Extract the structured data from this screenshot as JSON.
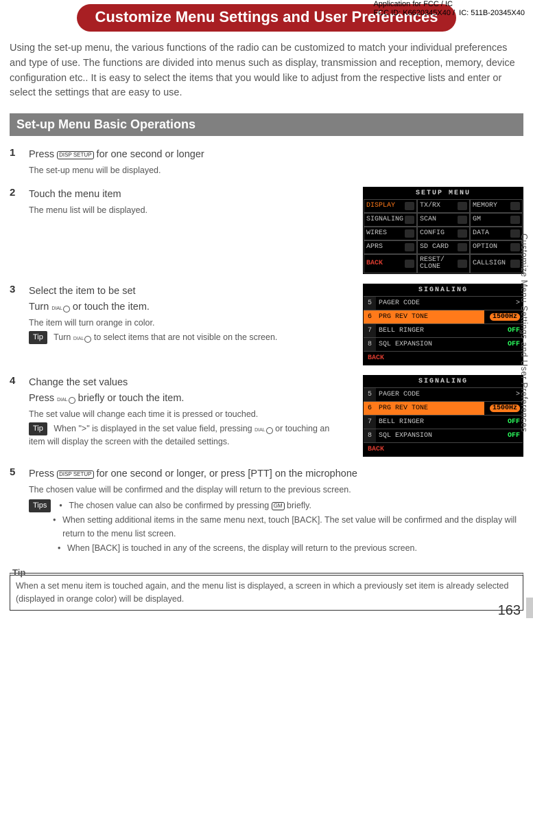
{
  "header": {
    "fcc_line1": "Application for FCC / IC",
    "fcc_line2": "FCC ID: K6620345X40 /  IC: 511B-20345X40",
    "banner": "Customize Menu Settings and User Preferences"
  },
  "intro": "Using the set-up menu, the various functions of the radio can be customized to match your individual preferences and type of use. The functions are divided into menus such as display, transmission and reception, memory, device configuration etc.. It is easy to select the items that you would like to adjust from the respective lists and enter or select the settings that are easy to use.",
  "section_title": "Set-up Menu Basic Operations",
  "keys": {
    "disp": "DISP\nSETUP",
    "gm": "GM"
  },
  "steps": {
    "s1": {
      "num": "1",
      "title_a": "Press ",
      "title_b": " for one second or longer",
      "sub": "The set-up menu will be displayed."
    },
    "s2": {
      "num": "2",
      "title": "Touch the menu item",
      "sub": "The menu list will be displayed."
    },
    "s3": {
      "num": "3",
      "title": "Select the item to be set",
      "line_a": "Turn ",
      "line_b": " or touch the item.",
      "sub": "The item will turn orange in color.",
      "tip_a": "Turn ",
      "tip_b": " to select items that are not visible on the screen."
    },
    "s4": {
      "num": "4",
      "title": "Change the set values",
      "line_a": "Press ",
      "line_b": " briefly or touch the item.",
      "sub": "The set value will change each time it is pressed or touched.",
      "tip_a": "When \">\" is displayed in the set value field, pressing ",
      "tip_b": " or touching an item will display the screen with the detailed settings."
    },
    "s5": {
      "num": "5",
      "title_a": "Press ",
      "title_b": " for one second or longer, or press [PTT] on the microphone",
      "sub": "The chosen value will be confirmed and the display will return to the previous screen.",
      "tips": {
        "t1a": "The chosen value can also be confirmed by pressing ",
        "t1b": " briefly.",
        "t2": "When setting additional items in the same menu next, touch [BACK]. The set value will be confirmed and the display will return to the menu list screen.",
        "t3": "When [BACK] is touched in any of the screens, the display will return to the previous screen."
      }
    }
  },
  "labels": {
    "tip": "Tip",
    "tips": "Tips"
  },
  "lcd_setup": {
    "title": "SETUP MENU",
    "cells": [
      [
        "DISPLAY",
        "TX/RX",
        "MEMORY"
      ],
      [
        "SIGNALING",
        "SCAN",
        "GM"
      ],
      [
        "WIRES",
        "CONFIG",
        "DATA"
      ],
      [
        "APRS",
        "SD CARD",
        "OPTION"
      ],
      [
        "BACK",
        "RESET/\nCLONE",
        "CALLSIGN"
      ]
    ]
  },
  "lcd_sig": {
    "title": "SIGNALING",
    "rows": [
      {
        "n": "5",
        "label": "PAGER CODE",
        "val": ">"
      },
      {
        "n": "6",
        "label": "PRG REV TONE",
        "val": "1500Hz",
        "sel": true
      },
      {
        "n": "7",
        "label": "BELL RINGER",
        "val": "OFF"
      },
      {
        "n": "8",
        "label": "SQL EXPANSION",
        "val": "OFF"
      }
    ],
    "back": "BACK"
  },
  "tipbox": {
    "title": "Tip",
    "body": "When a set menu item is touched again, and the menu list is displayed, a screen in which a previously set item is already selected (displayed in orange color) will be displayed."
  },
  "side": "Customize Menu Settings and User Preferences",
  "page_number": "163"
}
